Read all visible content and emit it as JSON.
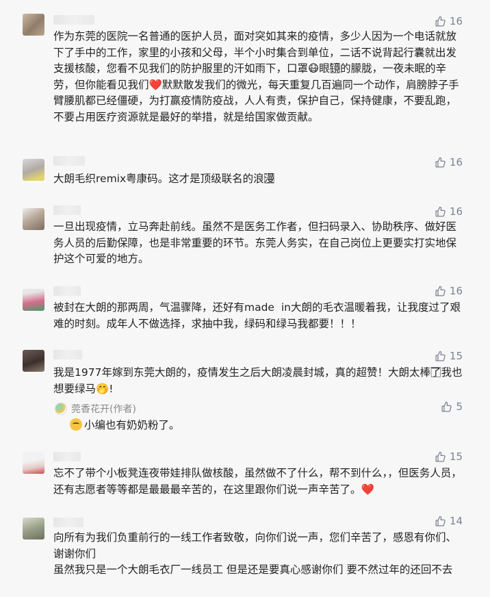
{
  "like_icon": "thumbs-up-icon",
  "colors": {
    "like": "#7a8290",
    "heart": "#e8435a",
    "background": "#f7f7f7"
  },
  "comments": [
    {
      "likes": "16",
      "text": "作为东莞的医院一名普通的医护人员，面对突如其来的疫情，多少人因为一个电话就放下了手中的工作，家里的小孩和父母，半个小时集合到单位，二话不说背起行囊就出发支援核酸，您看不见我们的防护服里的汗如雨下，口罩😷眼镜⃞的朦胧，一夜未眠的辛劳，但你能看见我们❤️默默散发我们的微光，每天重复几百遍同一个动作，肩膀脖子手臂腰肌都已经僵硬，为打赢疫情防疫战，人人有责，保护自己，保持健康，不要乱跑，不要占用医疗资源就是最好的举措，就是给国家做贡献。"
    },
    {
      "likes": "16",
      "text": "大朗毛织remix粤康码。这才是顶级联名的浪漫⃞"
    },
    {
      "likes": "16",
      "text": "一旦出现疫情，立马奔赴前线。虽然不是医务工作者，但扫码录入、协助秩序、做好医务人员的后勤保障，也是非常重要的环节。东莞人务实，在自己岗位上更要实打实地保护这个可爱的地方。"
    },
    {
      "likes": "16",
      "text": "被封在大朗的那两周，气温骤降，还好有made  in大朗的毛衣温暖着我，让我度过了艰难的时刻。成年人不做选择，求抽中我，绿码和绿马我都要！！！"
    },
    {
      "likes": "15",
      "text": "我是1977年嫁到东莞大朗的，疫情发生之后大朗凌晨封城，真的超赞！大朗太棒了⃞我也想要绿马🤭!",
      "reply": {
        "author": "莞香花开(作者)",
        "likes": "5",
        "text": "小编也有奶奶粉了。"
      }
    },
    {
      "likes": "15",
      "text": "忘不了带个小板凳连夜带娃排队做核酸，虽然做不了什么，帮不到什么，，但医务人员，还有志愿者等等都是最最最辛苦的，在这里跟你们说一声辛苦了。❤️"
    },
    {
      "likes": "14",
      "text": "向所有为我们负重前行的一线工作者致敬，向你们说一声，您们辛苦了，感恩有你们、谢谢你们\n虽然我只是一个大朗毛衣厂一线员工 但是还是要真心感谢你们 要不然过年的还回不去"
    }
  ]
}
